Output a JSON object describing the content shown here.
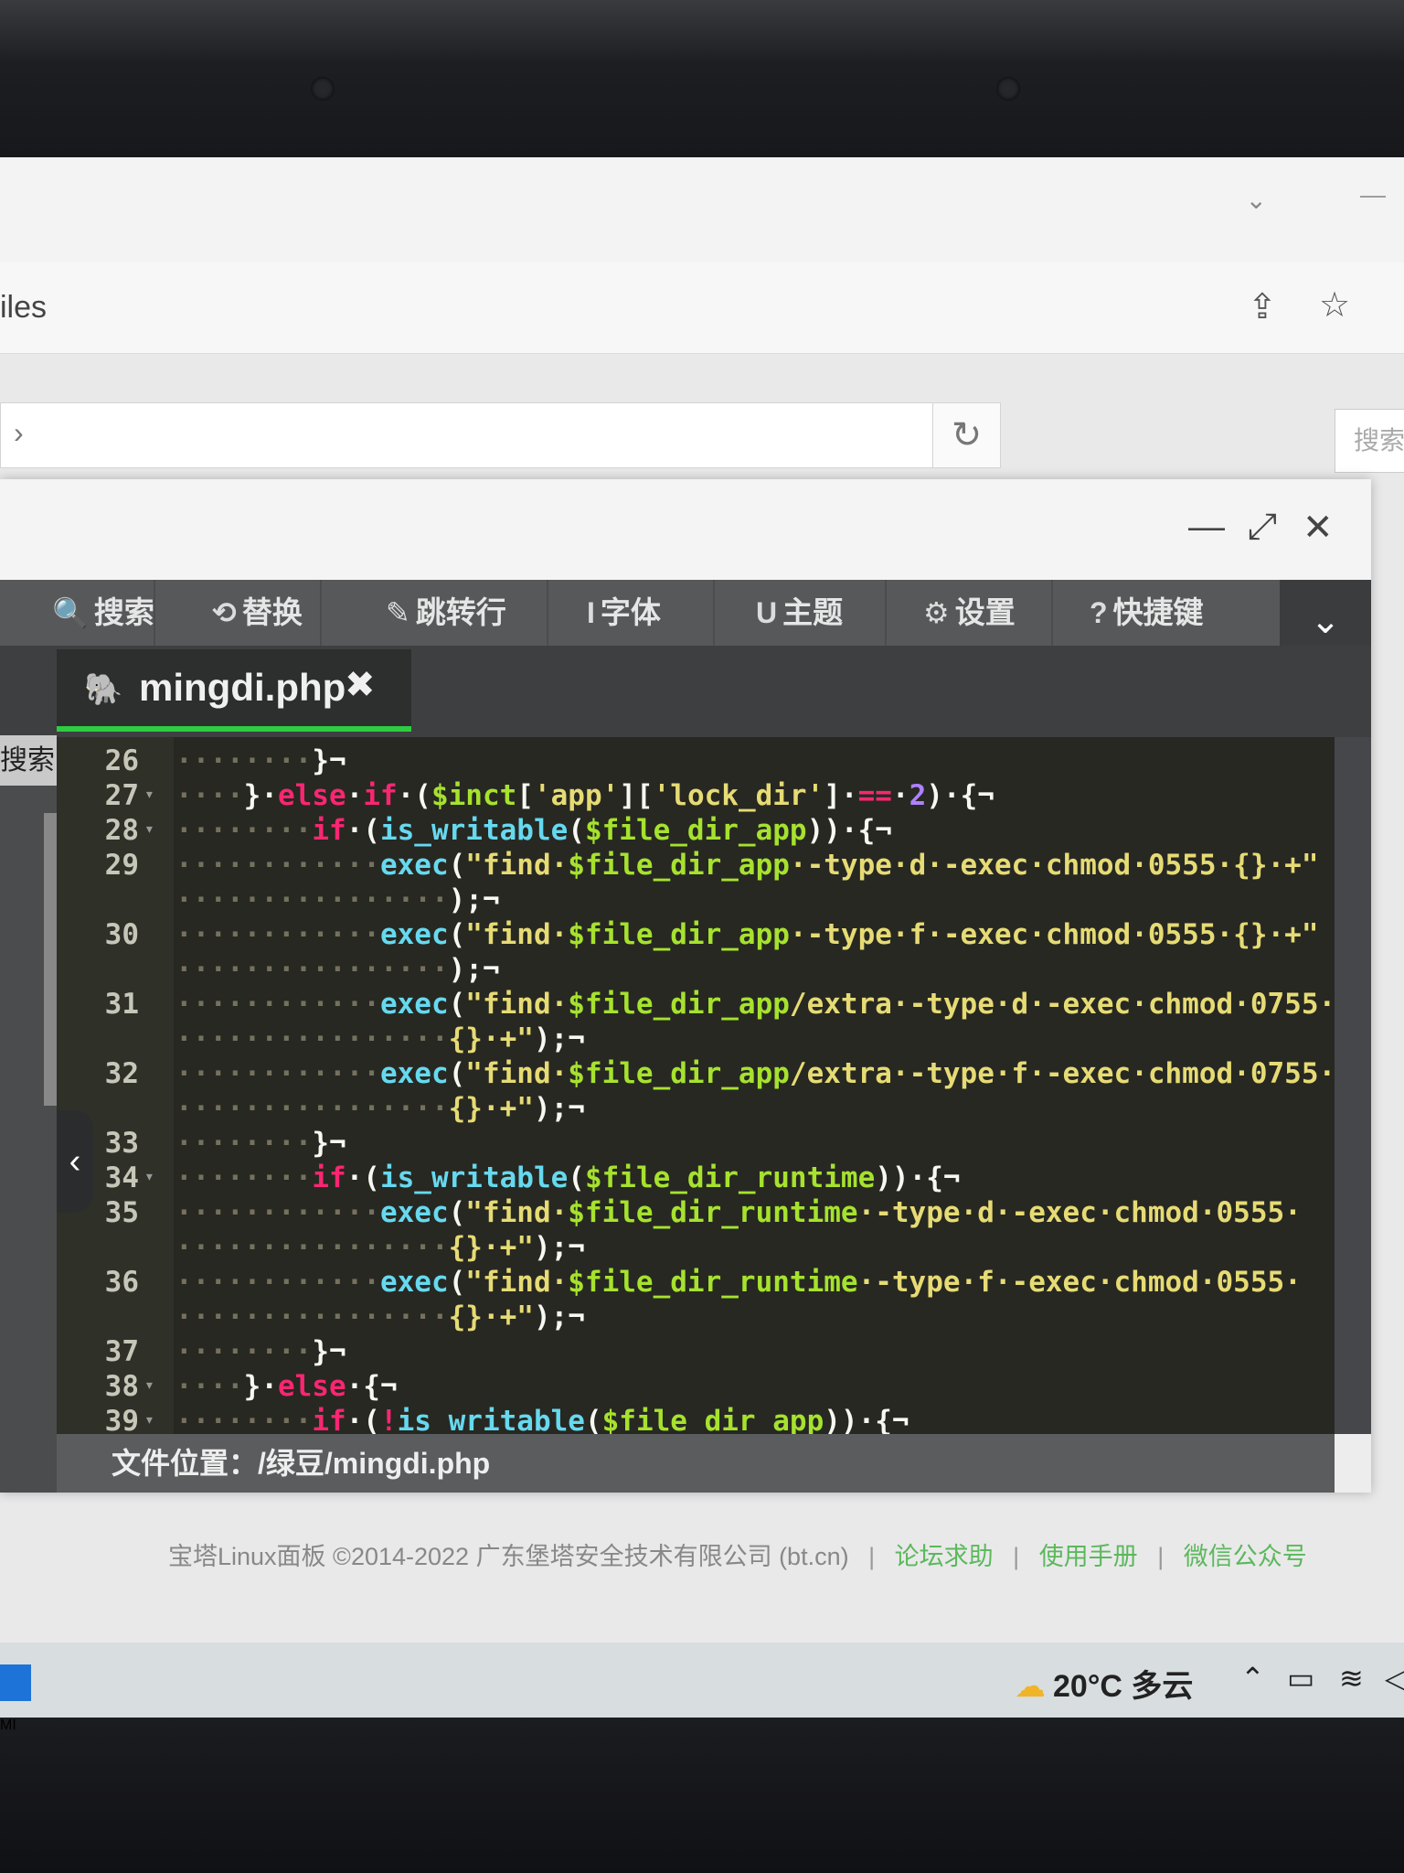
{
  "browser": {
    "url_fragment": "iles",
    "search_placeholder": "搜索"
  },
  "dialog": {
    "minimize": "—",
    "maximize": "⤢",
    "close": "✕"
  },
  "toolbar": {
    "items": [
      {
        "icon": "search-icon",
        "glyph": "🔍",
        "label": "搜索"
      },
      {
        "icon": "replace-icon",
        "glyph": "⟲",
        "label": "替换"
      },
      {
        "icon": "pin-icon",
        "glyph": "✎",
        "label": "跳转行"
      },
      {
        "icon": "font-icon",
        "glyph": "I",
        "label": "字体"
      },
      {
        "icon": "theme-icon",
        "glyph": "U",
        "label": "主题"
      },
      {
        "icon": "gear-icon",
        "glyph": "⚙",
        "label": "设置"
      },
      {
        "icon": "help-icon",
        "glyph": "?",
        "label": "快捷键"
      }
    ]
  },
  "side_label": "搜索",
  "tab": {
    "filename": "mingdi.php",
    "close": "✖"
  },
  "code": {
    "lines": [
      {
        "n": "26",
        "fold": false,
        "indent": "········",
        "parts": [
          [
            "pun",
            "}¬"
          ]
        ]
      },
      {
        "n": "27",
        "fold": true,
        "indent": "····",
        "parts": [
          [
            "pun",
            "}·"
          ],
          [
            "kw",
            "else"
          ],
          [
            "pun",
            "·"
          ],
          [
            "kw",
            "if"
          ],
          [
            "pun",
            "·("
          ],
          [
            "var",
            "$inct"
          ],
          [
            "pun",
            "["
          ],
          [
            "str",
            "'app'"
          ],
          [
            "pun",
            "]["
          ],
          [
            "str",
            "'lock_dir'"
          ],
          [
            "pun",
            "]·"
          ],
          [
            "kw",
            "=="
          ],
          [
            "pun",
            "·"
          ],
          [
            "num",
            "2"
          ],
          [
            "pun",
            ")·{¬"
          ]
        ]
      },
      {
        "n": "28",
        "fold": true,
        "indent": "········",
        "parts": [
          [
            "kw",
            "if"
          ],
          [
            "pun",
            "·("
          ],
          [
            "fn",
            "is_writable"
          ],
          [
            "pun",
            "("
          ],
          [
            "var",
            "$file_dir_app"
          ],
          [
            "pun",
            "))·{¬"
          ]
        ]
      },
      {
        "n": "29",
        "fold": false,
        "indent": "············",
        "parts": [
          [
            "fn",
            "exec"
          ],
          [
            "pun",
            "("
          ],
          [
            "str",
            "\"find·"
          ],
          [
            "var",
            "$file_dir_app"
          ],
          [
            "str",
            "·-type·d·-exec·chmod·0555·{}·+\""
          ]
        ]
      },
      {
        "n": "",
        "fold": false,
        "indent": "················",
        "parts": [
          [
            "pun",
            ");¬"
          ]
        ]
      },
      {
        "n": "30",
        "fold": false,
        "indent": "············",
        "parts": [
          [
            "fn",
            "exec"
          ],
          [
            "pun",
            "("
          ],
          [
            "str",
            "\"find·"
          ],
          [
            "var",
            "$file_dir_app"
          ],
          [
            "str",
            "·-type·f·-exec·chmod·0555·{}·+\""
          ]
        ]
      },
      {
        "n": "",
        "fold": false,
        "indent": "················",
        "parts": [
          [
            "pun",
            ");¬"
          ]
        ]
      },
      {
        "n": "31",
        "fold": false,
        "indent": "············",
        "parts": [
          [
            "fn",
            "exec"
          ],
          [
            "pun",
            "("
          ],
          [
            "str",
            "\"find·"
          ],
          [
            "var",
            "$file_dir_app"
          ],
          [
            "str",
            "/extra·-type·d·-exec·chmod·0755·"
          ]
        ]
      },
      {
        "n": "",
        "fold": false,
        "indent": "················",
        "parts": [
          [
            "str",
            "{}·+\""
          ],
          [
            "pun",
            ");¬"
          ]
        ]
      },
      {
        "n": "32",
        "fold": false,
        "indent": "············",
        "parts": [
          [
            "fn",
            "exec"
          ],
          [
            "pun",
            "("
          ],
          [
            "str",
            "\"find·"
          ],
          [
            "var",
            "$file_dir_app"
          ],
          [
            "str",
            "/extra·-type·f·-exec·chmod·0755·"
          ]
        ]
      },
      {
        "n": "",
        "fold": false,
        "indent": "················",
        "parts": [
          [
            "str",
            "{}·+\""
          ],
          [
            "pun",
            ");¬"
          ]
        ]
      },
      {
        "n": "33",
        "fold": false,
        "indent": "········",
        "parts": [
          [
            "pun",
            "}¬"
          ]
        ]
      },
      {
        "n": "34",
        "fold": true,
        "indent": "········",
        "parts": [
          [
            "kw",
            "if"
          ],
          [
            "pun",
            "·("
          ],
          [
            "fn",
            "is_writable"
          ],
          [
            "pun",
            "("
          ],
          [
            "var",
            "$file_dir_runtime"
          ],
          [
            "pun",
            "))·{¬"
          ]
        ]
      },
      {
        "n": "35",
        "fold": false,
        "indent": "············",
        "parts": [
          [
            "fn",
            "exec"
          ],
          [
            "pun",
            "("
          ],
          [
            "str",
            "\"find·"
          ],
          [
            "var",
            "$file_dir_runtime"
          ],
          [
            "str",
            "·-type·d·-exec·chmod·0555·"
          ]
        ]
      },
      {
        "n": "",
        "fold": false,
        "indent": "················",
        "parts": [
          [
            "str",
            "{}·+\""
          ],
          [
            "pun",
            ");¬"
          ]
        ]
      },
      {
        "n": "36",
        "fold": false,
        "indent": "············",
        "parts": [
          [
            "fn",
            "exec"
          ],
          [
            "pun",
            "("
          ],
          [
            "str",
            "\"find·"
          ],
          [
            "var",
            "$file_dir_runtime"
          ],
          [
            "str",
            "·-type·f·-exec·chmod·0555·"
          ]
        ]
      },
      {
        "n": "",
        "fold": false,
        "indent": "················",
        "parts": [
          [
            "str",
            "{}·+\""
          ],
          [
            "pun",
            ");¬"
          ]
        ]
      },
      {
        "n": "37",
        "fold": false,
        "indent": "········",
        "parts": [
          [
            "pun",
            "}¬"
          ]
        ]
      },
      {
        "n": "38",
        "fold": true,
        "indent": "····",
        "parts": [
          [
            "pun",
            "}·"
          ],
          [
            "kw",
            "else"
          ],
          [
            "pun",
            "·{¬"
          ]
        ]
      },
      {
        "n": "39",
        "fold": true,
        "indent": "········",
        "parts": [
          [
            "kw",
            "if"
          ],
          [
            "pun",
            "·("
          ],
          [
            "kw",
            "!"
          ],
          [
            "fn",
            "is_writable"
          ],
          [
            "pun",
            "("
          ],
          [
            "var",
            "$file_dir_app"
          ],
          [
            "pun",
            "))·{¬"
          ]
        ]
      }
    ]
  },
  "status": {
    "label": "文件位置：",
    "path": "/绿豆/mingdi.php"
  },
  "footer": {
    "copyright": "宝塔Linux面板 ©2014-2022 广东堡塔安全技术有限公司 (bt.cn)",
    "links": [
      "论坛求助",
      "使用手册",
      "微信公众号"
    ]
  },
  "taskbar": {
    "temperature": "20°C",
    "weather": "多云"
  },
  "bezel": {
    "logo": "MI"
  }
}
